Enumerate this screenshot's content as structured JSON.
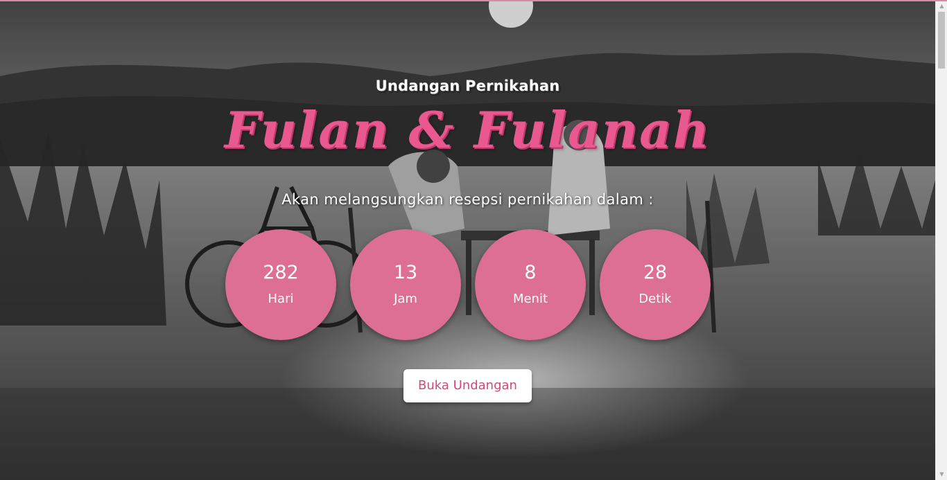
{
  "hero": {
    "subtitle": "Undangan Pernikahan",
    "couple_names": "Fulan & Fulanah",
    "lead_text": "Akan melangsungkan resepsi pernikahan dalam :"
  },
  "countdown": {
    "days": {
      "value": "282",
      "label": "Hari"
    },
    "hours": {
      "value": "13",
      "label": "Jam"
    },
    "minutes": {
      "value": "8",
      "label": "Menit"
    },
    "seconds": {
      "value": "28",
      "label": "Detik"
    }
  },
  "actions": {
    "open_invitation_label": "Buka Undangan"
  },
  "colors": {
    "accent_pink": "#dc6f93",
    "title_pink": "#e9588f",
    "button_text_pink": "#d5457e"
  },
  "icons": {
    "scroll_up": "scroll-up-arrow-icon",
    "scroll_down": "scroll-down-arrow-icon"
  }
}
